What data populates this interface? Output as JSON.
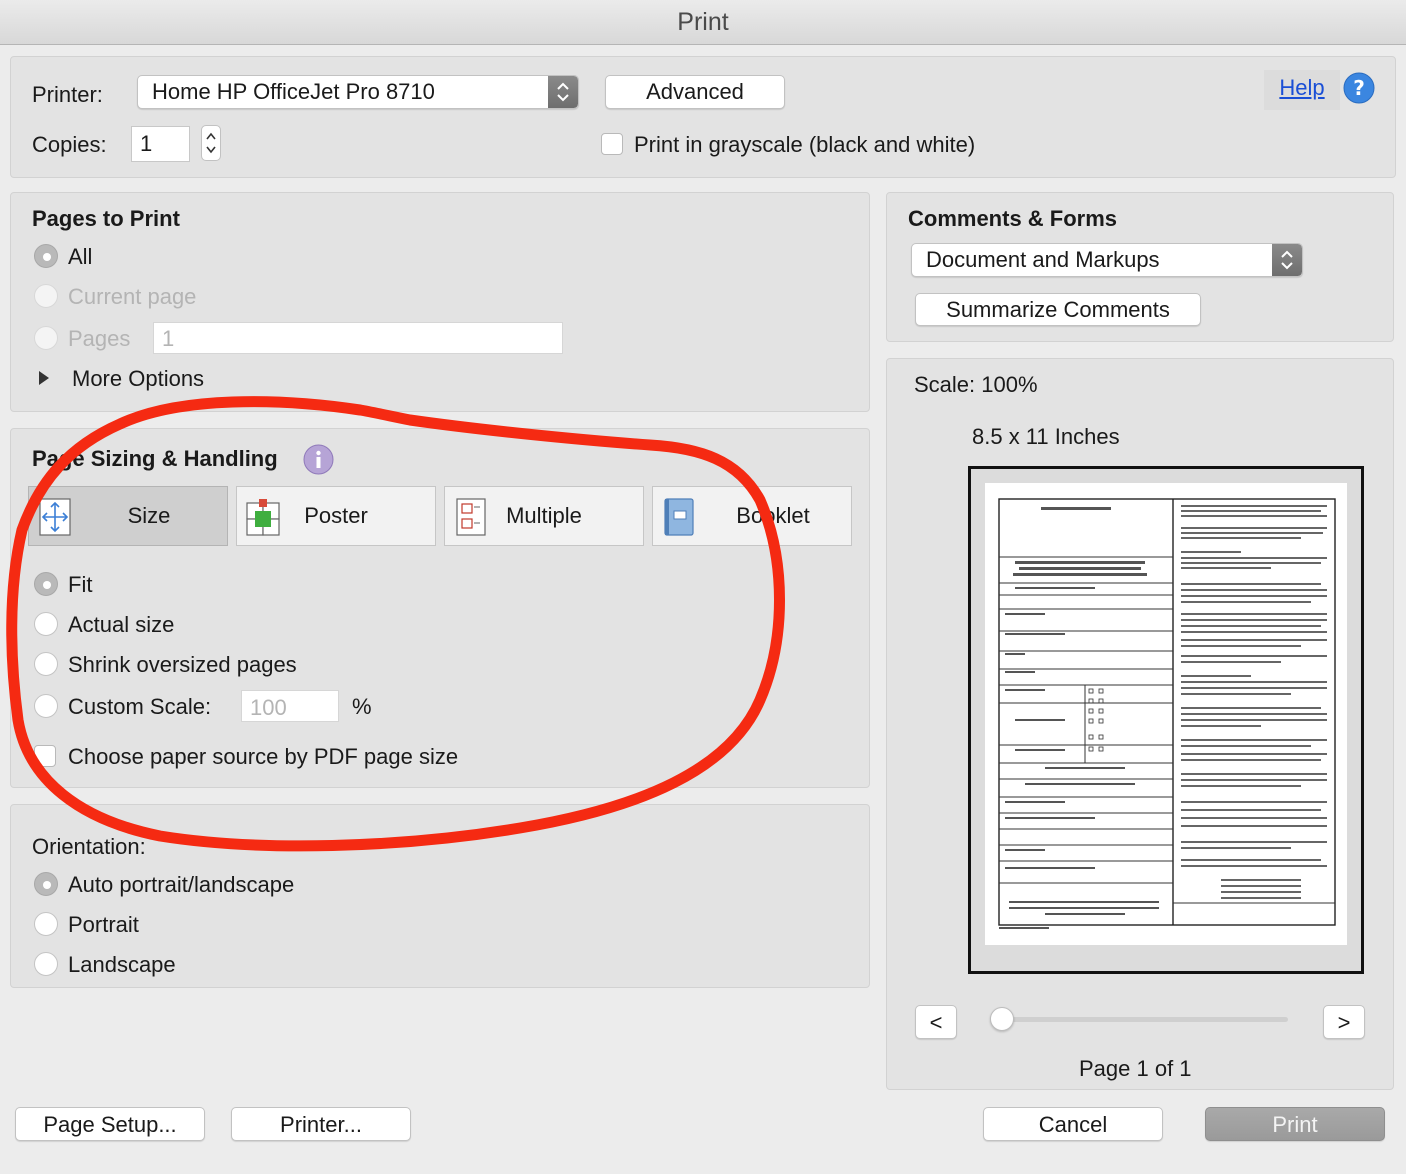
{
  "window": {
    "title": "Print"
  },
  "top": {
    "printer_label": "Printer:",
    "printer_value": "Home HP OfficeJet Pro 8710",
    "advanced_button": "Advanced",
    "help_link": "Help",
    "copies_label": "Copies:",
    "copies_value": "1",
    "grayscale_label": "Print in grayscale (black and white)",
    "grayscale_checked": false
  },
  "pages_to_print": {
    "title": "Pages to Print",
    "options": [
      "All",
      "Current page",
      "Pages"
    ],
    "selected": "All",
    "pages_value": "1",
    "more_options": "More Options"
  },
  "page_sizing": {
    "title": "Page Sizing & Handling",
    "tabs": [
      "Size",
      "Poster",
      "Multiple",
      "Booklet"
    ],
    "selected_tab": "Size",
    "options": [
      "Fit",
      "Actual size",
      "Shrink oversized pages",
      "Custom Scale:"
    ],
    "selected": "Fit",
    "custom_scale_value": "100",
    "percent_sign": "%",
    "paper_source_label": "Choose paper source by PDF page size"
  },
  "orientation": {
    "title": "Orientation:",
    "options": [
      "Auto portrait/landscape",
      "Portrait",
      "Landscape"
    ],
    "selected": "Auto portrait/landscape"
  },
  "comments_forms": {
    "title": "Comments & Forms",
    "select_value": "Document and Markups",
    "summarize_button": "Summarize Comments"
  },
  "preview": {
    "scale_text": "Scale: 100%",
    "paper_size": "8.5 x 11 Inches",
    "prev_button": "<",
    "next_button": ">",
    "page_indicator": "Page 1 of 1"
  },
  "footer": {
    "page_setup_button": "Page Setup...",
    "printer_button": "Printer...",
    "cancel_button": "Cancel",
    "print_button": "Print"
  },
  "annotation": {
    "color": "#f52a12"
  },
  "icons": {
    "help": "help-icon",
    "info": "info-icon",
    "size": "size-icon",
    "poster": "poster-icon",
    "multiple": "multiple-icon",
    "booklet": "booklet-icon"
  }
}
